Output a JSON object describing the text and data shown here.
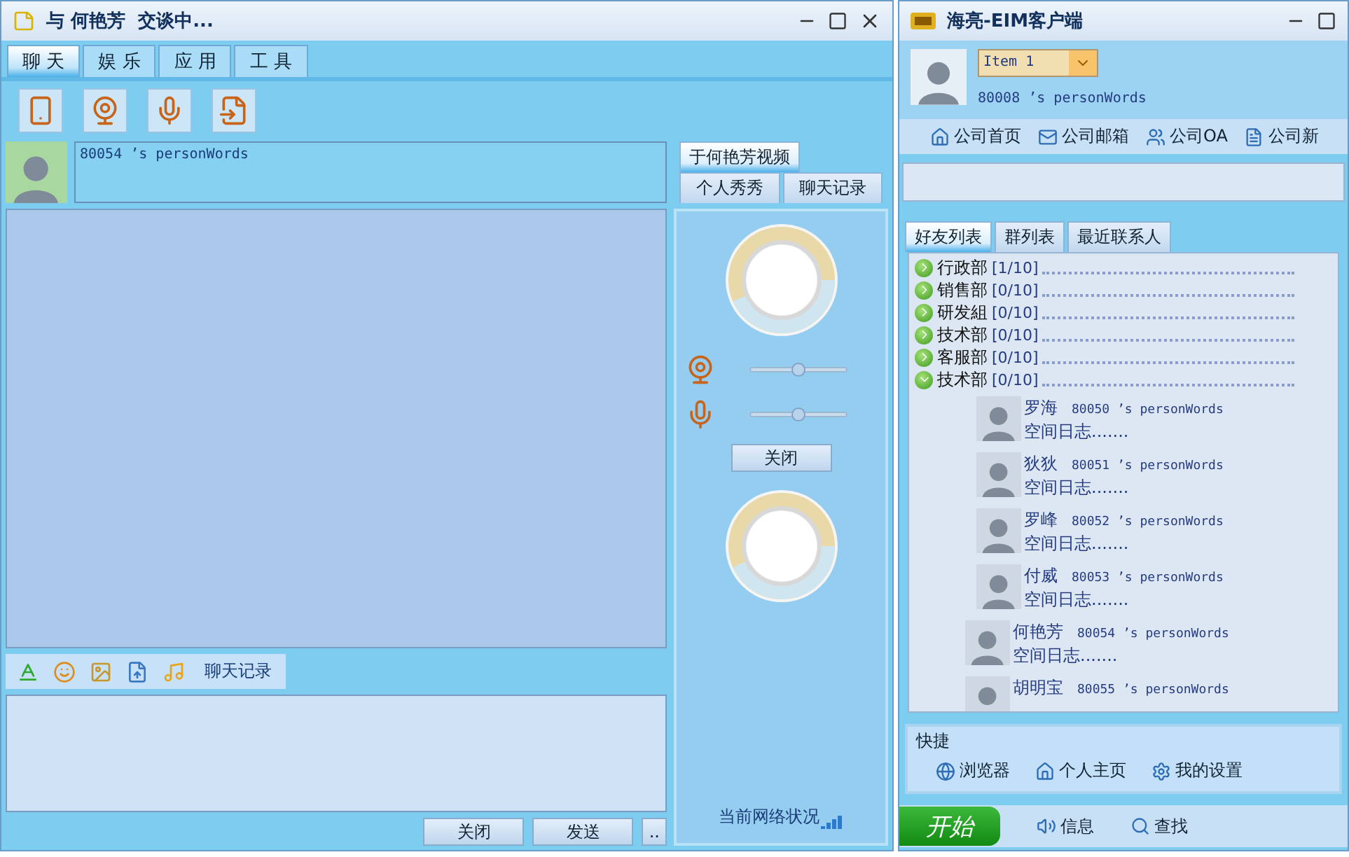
{
  "chat_window": {
    "title": "与 何艳芳  交谈中...",
    "menu_tabs": [
      {
        "label": "聊 天",
        "selected": true
      },
      {
        "label": "娱 乐",
        "selected": false
      },
      {
        "label": "应 用",
        "selected": false
      },
      {
        "label": "工 具",
        "selected": false
      }
    ],
    "contact_signature": "80054 ’s personWords",
    "video_tab": {
      "label": "于何艳芳视频",
      "selected": true
    },
    "side_tabs": [
      {
        "label": "个人秀秀",
        "selected": false
      },
      {
        "label": "聊天记录",
        "selected": false
      }
    ],
    "sliders": [
      {
        "kind": "camera",
        "level": 0.5
      },
      {
        "kind": "microphone",
        "level": 0.5
      }
    ],
    "close_video_button": "关闭",
    "network_status": "当前网络状况",
    "history_label": "聊天记录",
    "buttons": [
      "关闭",
      "发送",
      ".."
    ]
  },
  "client_window": {
    "title": "海亮-EIM客户端",
    "status_combo": "Item 1",
    "signature": "80008 ’s personWords",
    "links": [
      {
        "kind": "home",
        "label": "公司首页"
      },
      {
        "kind": "mail",
        "label": "公司邮箱"
      },
      {
        "kind": "oa",
        "label": "公司OA"
      },
      {
        "kind": "news",
        "label": "公司新"
      }
    ],
    "list_tabs": [
      {
        "label": "好友列表",
        "selected": true
      },
      {
        "label": "群列表",
        "selected": false
      },
      {
        "label": "最近联系人",
        "selected": false
      }
    ],
    "groups": [
      {
        "name": "行政部",
        "count": "[1/10]",
        "expanded": false
      },
      {
        "name": "销售部",
        "count": "[0/10]",
        "expanded": false
      },
      {
        "name": "研发組",
        "count": "[0/10]",
        "expanded": false
      },
      {
        "name": "技术部",
        "count": "[0/10]",
        "expanded": false
      },
      {
        "name": "客服部",
        "count": "[0/10]",
        "expanded": false
      },
      {
        "name": "技术部",
        "count": "[0/10]",
        "expanded": true,
        "children": [
          {
            "name": "罗海",
            "words": "80050 ’s personWords",
            "blog": "空间日志......."
          },
          {
            "name": "狄狄",
            "words": "80051 ’s personWords",
            "blog": "空间日志......."
          },
          {
            "name": "罗峰",
            "words": "80052 ’s personWords",
            "blog": "空间日志......."
          },
          {
            "name": "付威",
            "words": "80053 ’s personWords",
            "blog": "空间日志......."
          },
          {
            "name": "何艳芳",
            "words": "80054 ’s personWords",
            "blog": "空间日志......."
          },
          {
            "name": "胡明宝",
            "words": "80055 ’s personWords"
          }
        ]
      }
    ],
    "quick": {
      "title": "快捷",
      "items": [
        {
          "kind": "browser",
          "label": "浏览器"
        },
        {
          "kind": "home",
          "label": "个人主页"
        },
        {
          "kind": "settings",
          "label": "我的设置"
        }
      ]
    },
    "taskbar": {
      "start": "开始",
      "items": [
        {
          "kind": "message",
          "label": "信息"
        },
        {
          "kind": "search",
          "label": "查找"
        }
      ]
    }
  }
}
